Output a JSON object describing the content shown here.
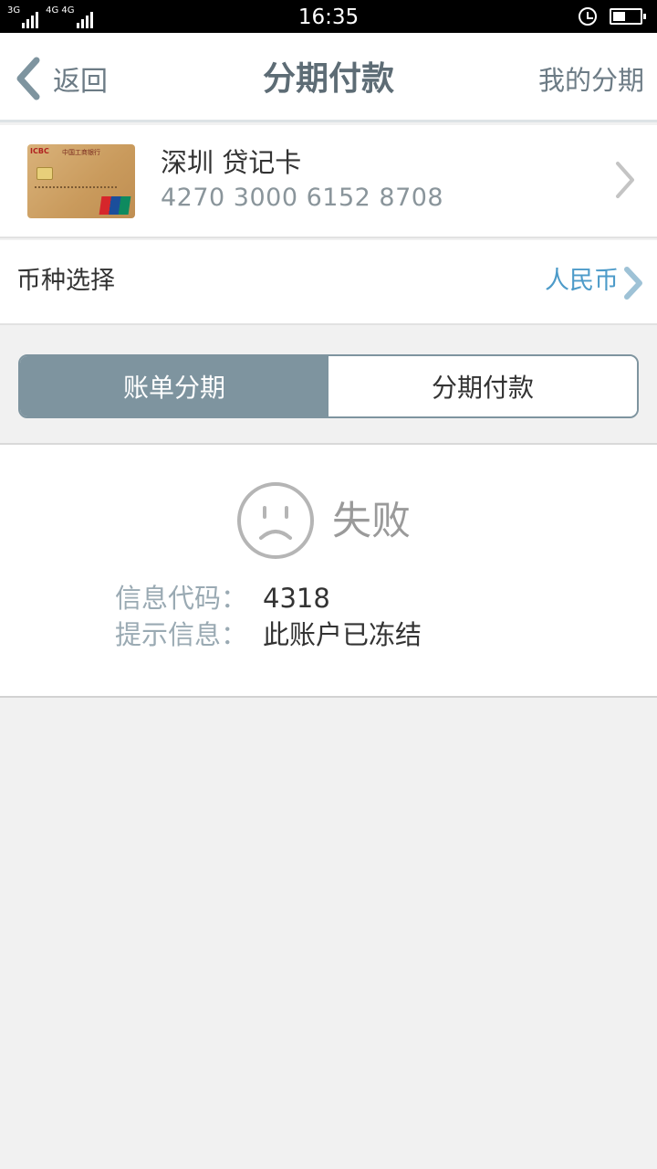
{
  "status_bar": {
    "network_left": "3G",
    "network_right": "4G 4G",
    "time": "16:35",
    "battery_level": 0.4
  },
  "header": {
    "back_label": "返回",
    "title": "分期付款",
    "right_link": "我的分期"
  },
  "card": {
    "name": "深圳 贷记卡",
    "number": "4270 3000 6152 8708",
    "card_brand_text": "ICBC",
    "card_bank_text": "中国工商银行"
  },
  "currency": {
    "label": "币种选择",
    "value": "人民币"
  },
  "tabs": [
    {
      "label": "账单分期",
      "active": true
    },
    {
      "label": "分期付款",
      "active": false
    }
  ],
  "result": {
    "status": "失败",
    "info_code_label": "信息代码：",
    "info_code_value": "4318",
    "hint_label": "提示信息：",
    "hint_value": "此账户已冻结"
  },
  "colors": {
    "accent": "#7e949f",
    "link_blue": "#4d9bc9",
    "title_gray": "#5d6c75"
  }
}
